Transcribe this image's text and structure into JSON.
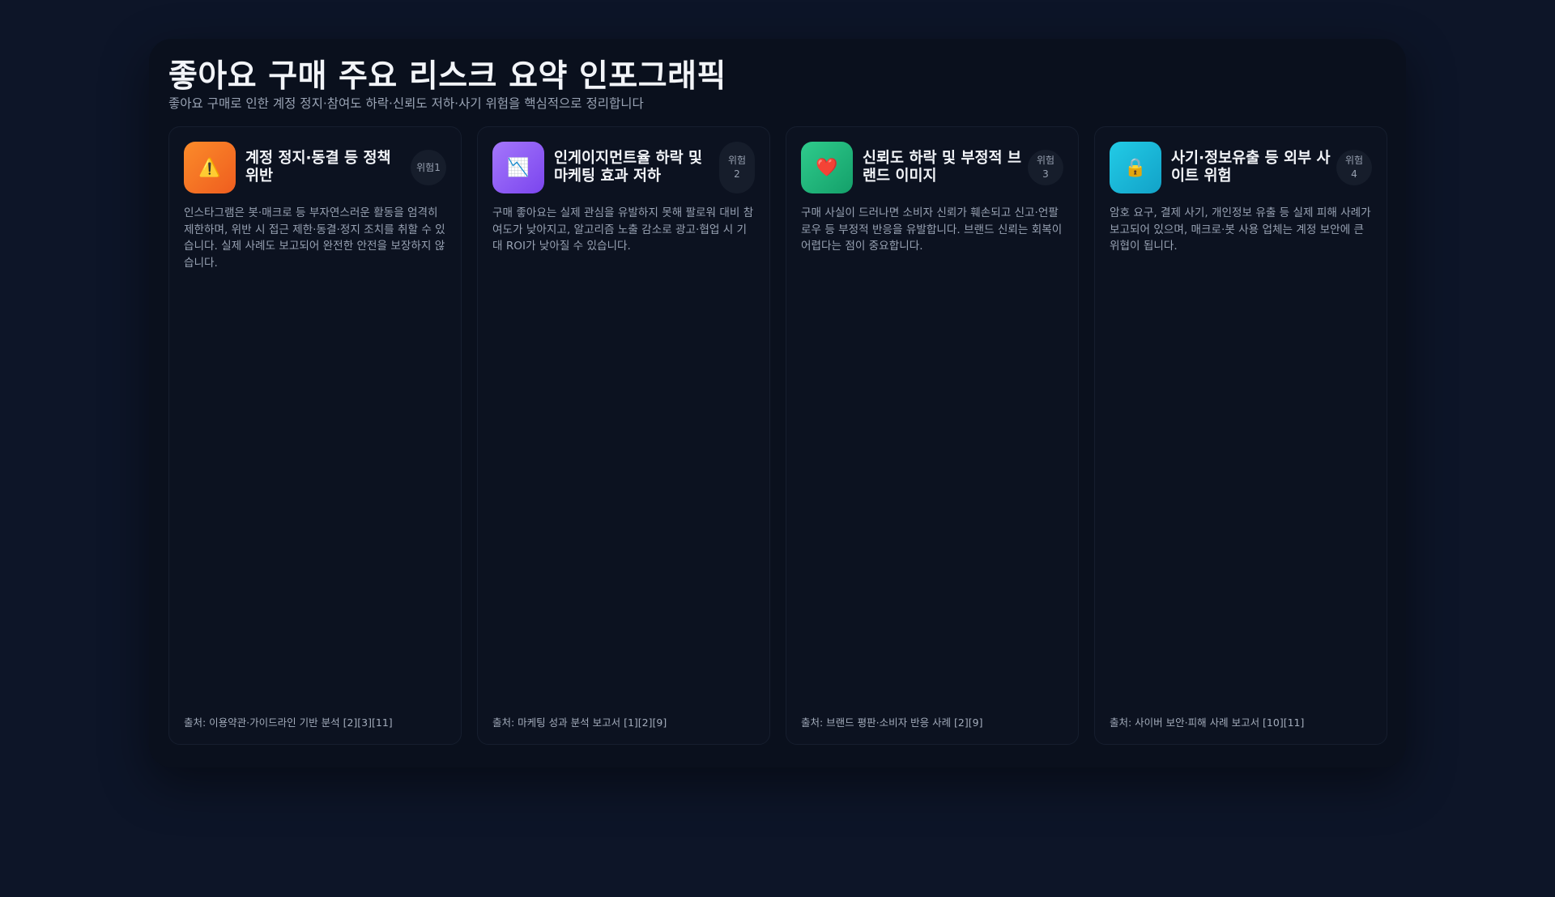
{
  "header": {
    "title": "좋아요 구매 주요 리스크 요약 인포그래픽",
    "subtitle": "좋아요 구매로 인한 계정 정지·참여도 하락·신뢰도 저하·사기 위험을 핵심적으로 정리합니다"
  },
  "cards": [
    {
      "icon": "⚠️",
      "icon_name": "warning-icon",
      "icon_color": "#f5761f",
      "title": "계정 정지·동결 등 정책 위반",
      "badge": "위험1",
      "body": "인스타그램은 봇·매크로 등 부자연스러운 활동을 엄격히 제한하며, 위반 시 접근 제한·동결·정지 조치를 취할 수 있습니다. 실제 사례도 보고되어 완전한 안전을 보장하지 않습니다.",
      "source": "출처: 이용약관·가이드라인 기반 분석 [2][3][11]"
    },
    {
      "icon": "📉",
      "icon_name": "chart-down-icon",
      "icon_color": "#8c5cf5",
      "title": "인게이지먼트율 하락 및 마케팅 효과 저하",
      "badge": "위험2",
      "body": "구매 좋아요는 실제 관심을 유발하지 못해 팔로워 대비 참여도가 낮아지고, 알고리즘 노출 감소로 광고·협업 시 기대 ROI가 낮아질 수 있습니다.",
      "source": "출처: 마케팅 성과 분석 보고서 [1][2][9]"
    },
    {
      "icon": "❤️",
      "icon_name": "heart-icon",
      "icon_color": "#1fb57b",
      "title": "신뢰도 하락 및 부정적 브랜드 이미지",
      "badge": "위험3",
      "body": "구매 사실이 드러나면 소비자 신뢰가 훼손되고 신고·언팔로우 등 부정적 반응을 유발합니다. 브랜드 신뢰는 회복이 어렵다는 점이 중요합니다.",
      "source": "출처: 브랜드 평판·소비자 반응 사례 [2][9]"
    },
    {
      "icon": "🔒",
      "icon_name": "lock-icon",
      "icon_color": "#19b6d8",
      "title": "사기·정보유출 등 외부 사이트 위험",
      "badge": "위험4",
      "body": "암호 요구, 결제 사기, 개인정보 유출 등 실제 피해 사례가 보고되어 있으며, 매크로·봇 사용 업체는 계정 보안에 큰 위협이 됩니다.",
      "source": "출처: 사이버 보안·피해 사례 보고서 [10][11]"
    }
  ]
}
